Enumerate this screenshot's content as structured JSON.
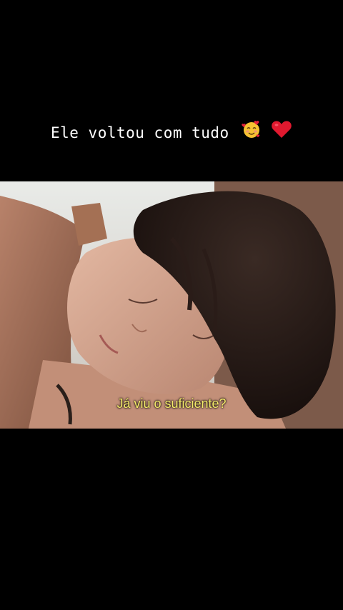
{
  "caption": {
    "text": "Ele voltou com tudo",
    "emojis": [
      "smiling-face-with-hearts",
      "red-heart"
    ]
  },
  "video": {
    "subtitle": "Já viu o suficiente?",
    "subtitle_color": "#f5eb6a"
  }
}
